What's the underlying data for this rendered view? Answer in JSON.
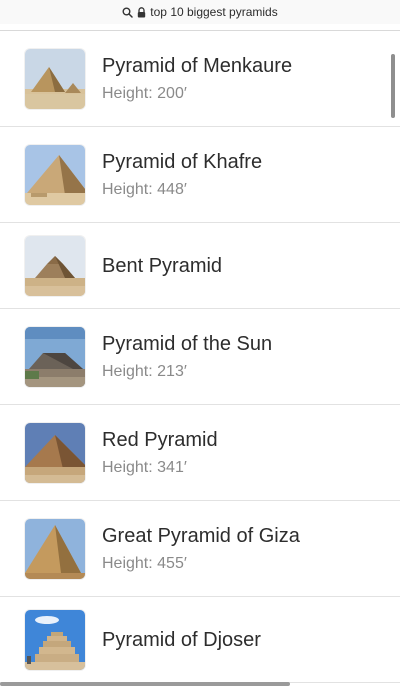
{
  "browser": {
    "url_text": "top 10 biggest pyramids",
    "search_icon": "search-icon",
    "lock_icon": "lock-icon"
  },
  "items": [
    {
      "title": "Pyramid of Menkaure",
      "subtitle": "Height: 200′",
      "thumb": "menkaure-thumbnail"
    },
    {
      "title": "Pyramid of Khafre",
      "subtitle": "Height: 448′",
      "thumb": "khafre-thumbnail"
    },
    {
      "title": "Bent Pyramid",
      "subtitle": "",
      "thumb": "bent-pyramid-thumbnail"
    },
    {
      "title": "Pyramid of the Sun",
      "subtitle": "Height: 213′",
      "thumb": "sun-pyramid-thumbnail"
    },
    {
      "title": "Red Pyramid",
      "subtitle": "Height: 341′",
      "thumb": "red-pyramid-thumbnail"
    },
    {
      "title": "Great Pyramid of Giza",
      "subtitle": "Height: 455′",
      "thumb": "giza-thumbnail"
    },
    {
      "title": "Pyramid of Djoser",
      "subtitle": "",
      "thumb": "djoser-thumbnail"
    }
  ],
  "colors": {
    "title": "#2d2d2d",
    "subtitle": "#8a8a8a",
    "divider": "#e2e2e2"
  }
}
